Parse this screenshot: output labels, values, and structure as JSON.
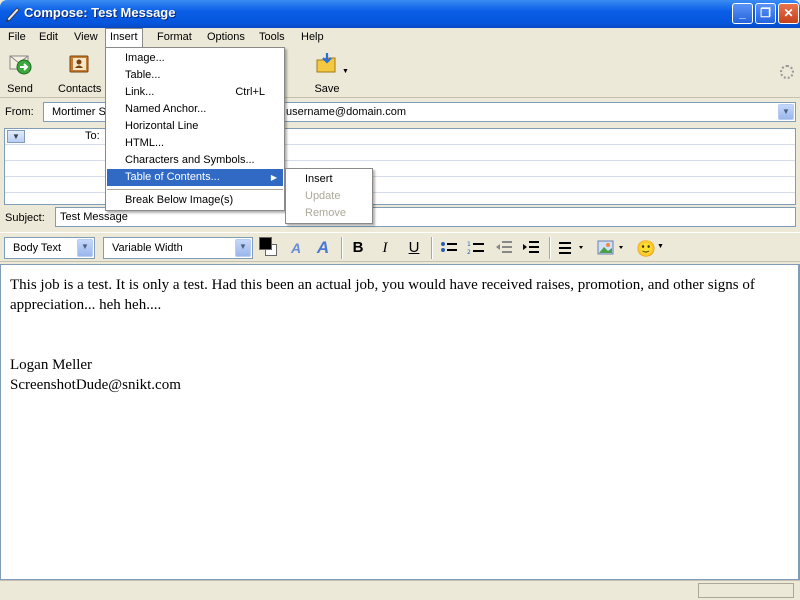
{
  "window": {
    "title": "Compose: Test Message",
    "minimize_glyph": "_",
    "maximize_glyph": "❐",
    "close_glyph": "✕"
  },
  "menubar": [
    "File",
    "Edit",
    "View",
    "Insert",
    "Format",
    "Options",
    "Tools",
    "Help"
  ],
  "toolbar": {
    "send": "Send",
    "contacts": "Contacts",
    "save": "Save"
  },
  "from": {
    "label": "From:",
    "name_partial": "Mortimer S",
    "email_partial": "username@domain.com"
  },
  "to": {
    "label": "To:"
  },
  "subject": {
    "label": "Subject:",
    "value": "Test Message"
  },
  "format": {
    "paragraph_style": "Body Text",
    "font": "Variable Width",
    "bold": "B",
    "italic": "I",
    "underline": "U",
    "emoji": "🙂"
  },
  "body": {
    "line1": "This job is a test.  It is only a test.  Had this been an actual job, you would have received raises, promotion, and other signs of appreciation... heh heh....",
    "sig_name": "Logan Meller",
    "sig_email": "ScreenshotDude@snikt.com"
  },
  "insert_menu": [
    {
      "label": "Image..."
    },
    {
      "label": "Table..."
    },
    {
      "label": "Link...",
      "shortcut": "Ctrl+L"
    },
    {
      "label": "Named Anchor..."
    },
    {
      "label": "Horizontal Line"
    },
    {
      "label": "HTML..."
    },
    {
      "label": "Characters and Symbols..."
    },
    {
      "label": "Table of Contents..."
    },
    {
      "label": "Break Below Image(s)"
    }
  ],
  "toc_submenu": [
    {
      "label": "Insert"
    },
    {
      "label": "Update"
    },
    {
      "label": "Remove"
    }
  ],
  "colors": {
    "titlebar": "#0a5ee6",
    "highlight": "#316ac5"
  }
}
